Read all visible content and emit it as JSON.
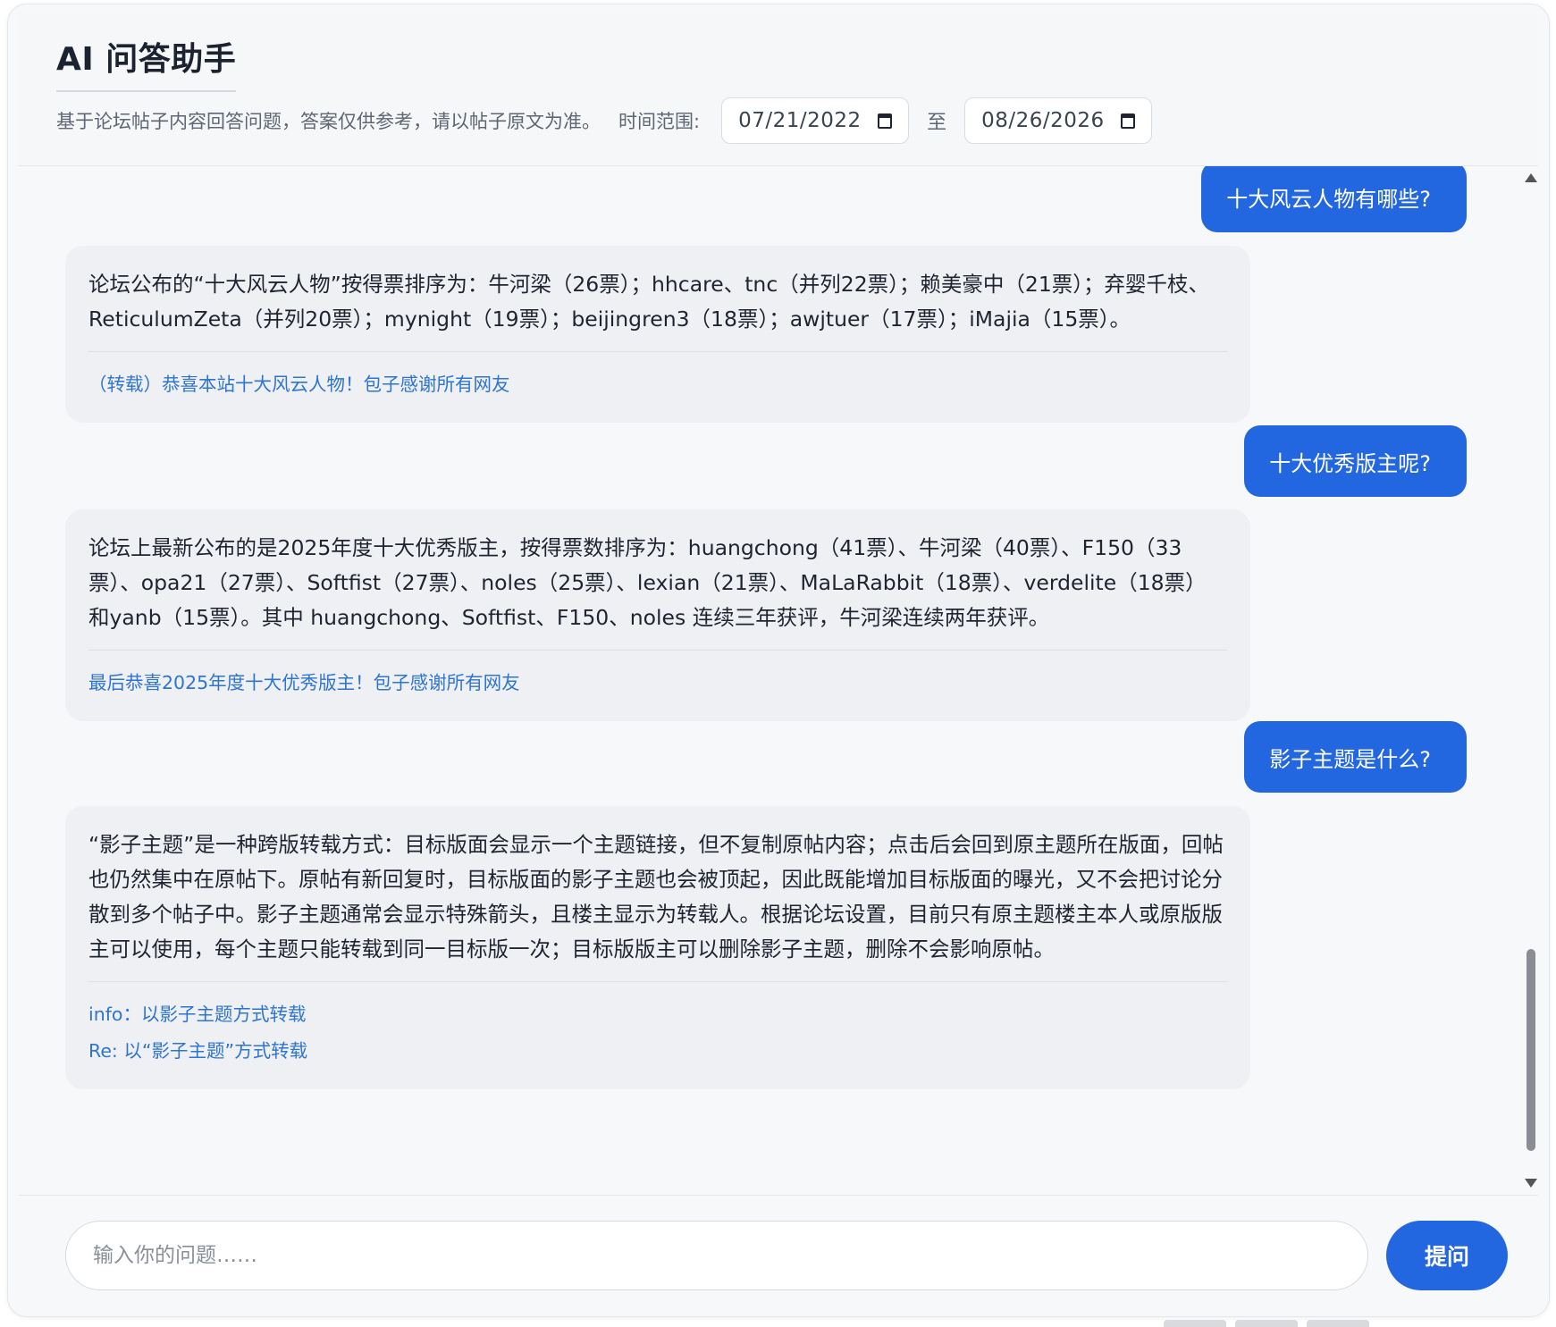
{
  "header": {
    "title": "AI 问答助手",
    "subtitle": "基于论坛帖子内容回答问题，答案仅供参考，请以帖子原文为准。",
    "range_label": "时间范围:",
    "date_from": "07/21/2022",
    "to_label": "至",
    "date_to": "08/26/2026"
  },
  "conversation": {
    "q1": "十大风云人物有哪些?",
    "a1": {
      "text": "论坛公布的“十大风云人物”按得票排序为：牛河梁（26票）；hhcare、tnc（并列22票）；赖美豪中（21票）；弃婴千枝、ReticulumZeta（并列20票）；mynight（19票）；beijingren3（18票）；awjtuer（17票）；iMajia（15票）。",
      "sources": [
        "（转载）恭喜本站十大风云人物！包子感谢所有网友"
      ]
    },
    "q2": "十大优秀版主呢?",
    "a2": {
      "text": "论坛上最新公布的是2025年度十大优秀版主，按得票数排序为：huangchong（41票）、牛河梁（40票）、F150（33票）、opa21（27票）、Softfist（27票）、noles（25票）、lexian（21票）、MaLaRabbit（18票）、verdelite（18票）和yanb（15票）。其中 huangchong、Softfist、F150、noles 连续三年获评，牛河梁连续两年获评。",
      "sources": [
        "最后恭喜2025年度十大优秀版主！包子感谢所有网友"
      ]
    },
    "q3": "影子主题是什么?",
    "a3": {
      "text": "“影子主题”是一种跨版转载方式：目标版面会显示一个主题链接，但不复制原帖内容；点击后会回到原主题所在版面，回帖也仍然集中在原帖下。原帖有新回复时，目标版面的影子主题也会被顶起，因此既能增加目标版面的曝光，又不会把讨论分散到多个帖子中。影子主题通常会显示特殊箭头，且楼主显示为转载人。根据论坛设置，目前只有原主题楼主本人或原版版主可以使用，每个主题只能转载到同一目标版一次；目标版版主可以删除影子主题，删除不会影响原帖。",
      "sources": [
        "info：以影子主题方式转载",
        "Re: 以“影子主题”方式转载"
      ]
    }
  },
  "composer": {
    "placeholder": "输入你的问题……",
    "submit_label": "提问"
  },
  "colors": {
    "accent": "#2266e0",
    "link": "#2f74d0",
    "ai_bubble": "#eef0f3"
  }
}
